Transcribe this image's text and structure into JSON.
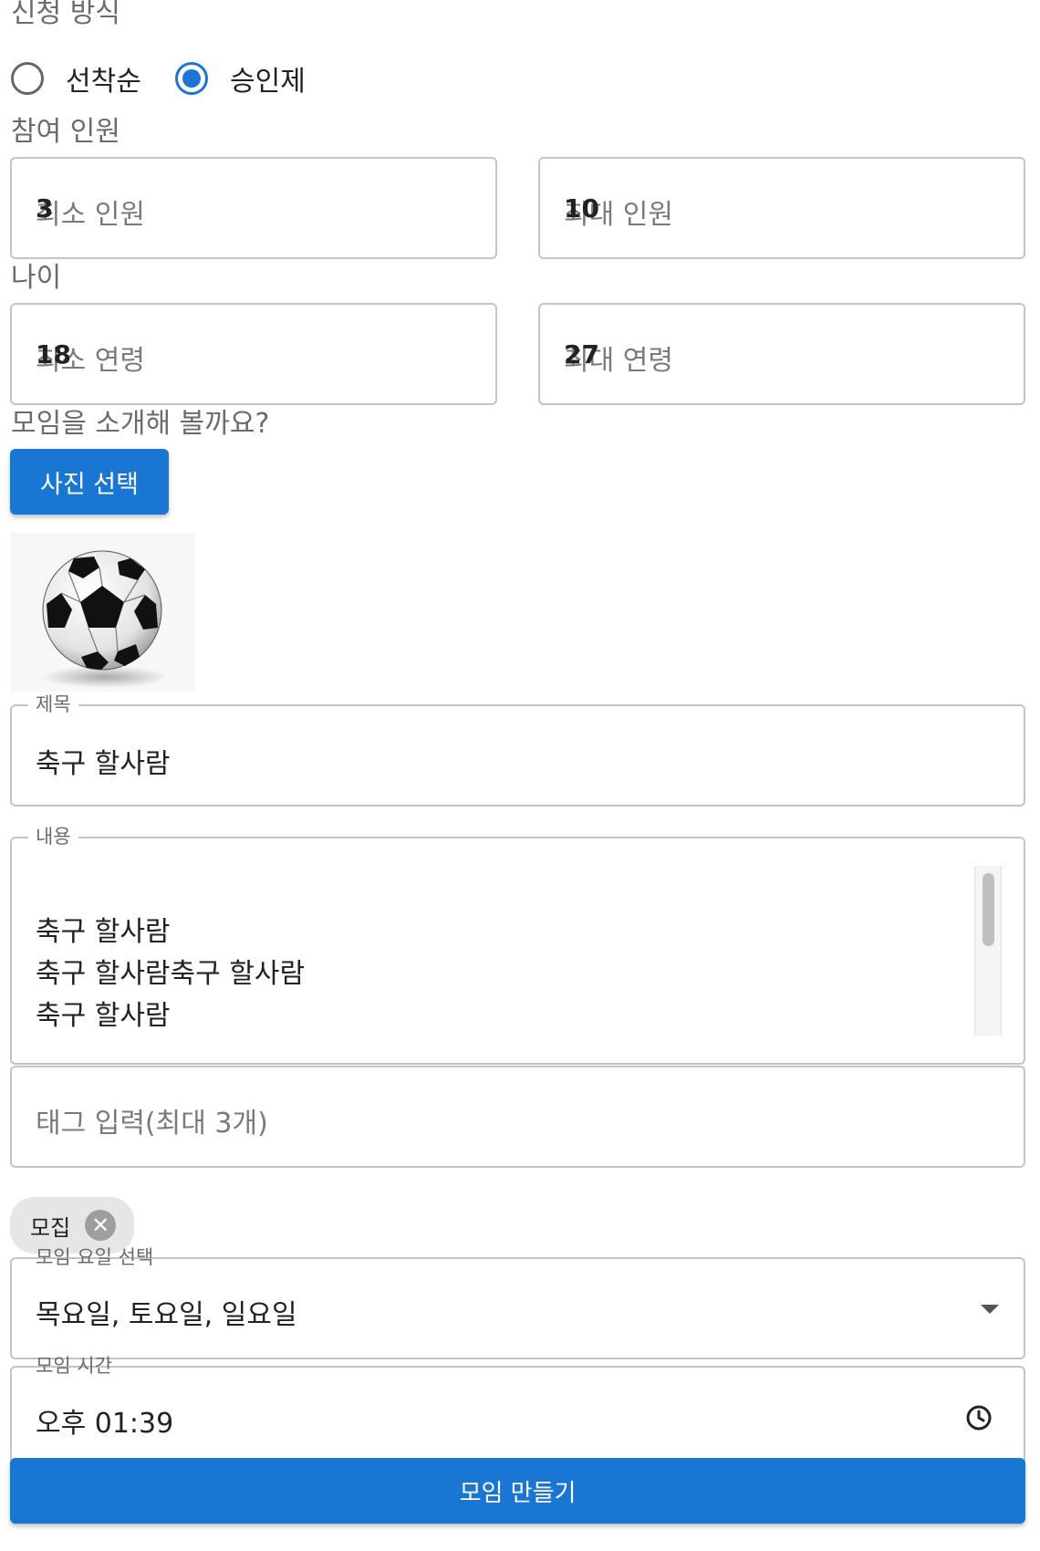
{
  "apply_method": {
    "label": "신청 방식",
    "options": [
      {
        "label": "선착순",
        "selected": false
      },
      {
        "label": "승인제",
        "selected": true
      }
    ]
  },
  "participants": {
    "label": "참여 인원",
    "min": {
      "placeholder": "최소 인원",
      "value": "3"
    },
    "max": {
      "placeholder": "최대 인원",
      "value": "10"
    }
  },
  "age": {
    "label": "나이",
    "min": {
      "placeholder": "최소 연령",
      "value": "18"
    },
    "max": {
      "placeholder": "최대 연령",
      "value": "27"
    }
  },
  "intro": {
    "label": "모임을 소개해 볼까요?",
    "photo_button": "사진 선택"
  },
  "title_field": {
    "legend": "제목",
    "value": "축구 할사람"
  },
  "content_field": {
    "legend": "내용",
    "lines": [
      "축구 할사람",
      "축구 할사람축구 할사람",
      "축구 할사람"
    ]
  },
  "tag_field": {
    "placeholder": "태그 입력(최대 3개)"
  },
  "tags": [
    {
      "label": "모집"
    }
  ],
  "days_field": {
    "legend": "모임 요일 선택",
    "value": "목요일, 토요일, 일요일"
  },
  "time_field": {
    "legend": "모임 시간",
    "value": "오후 01:39"
  },
  "submit_button": "모임 만들기",
  "colors": {
    "accent": "#1976d2",
    "border": "#c4c4c4",
    "chip": "#e6e6e6"
  },
  "icons": {
    "tag_remove": "close-circle-icon",
    "dropdown": "caret-down-icon",
    "time": "clock-icon"
  }
}
